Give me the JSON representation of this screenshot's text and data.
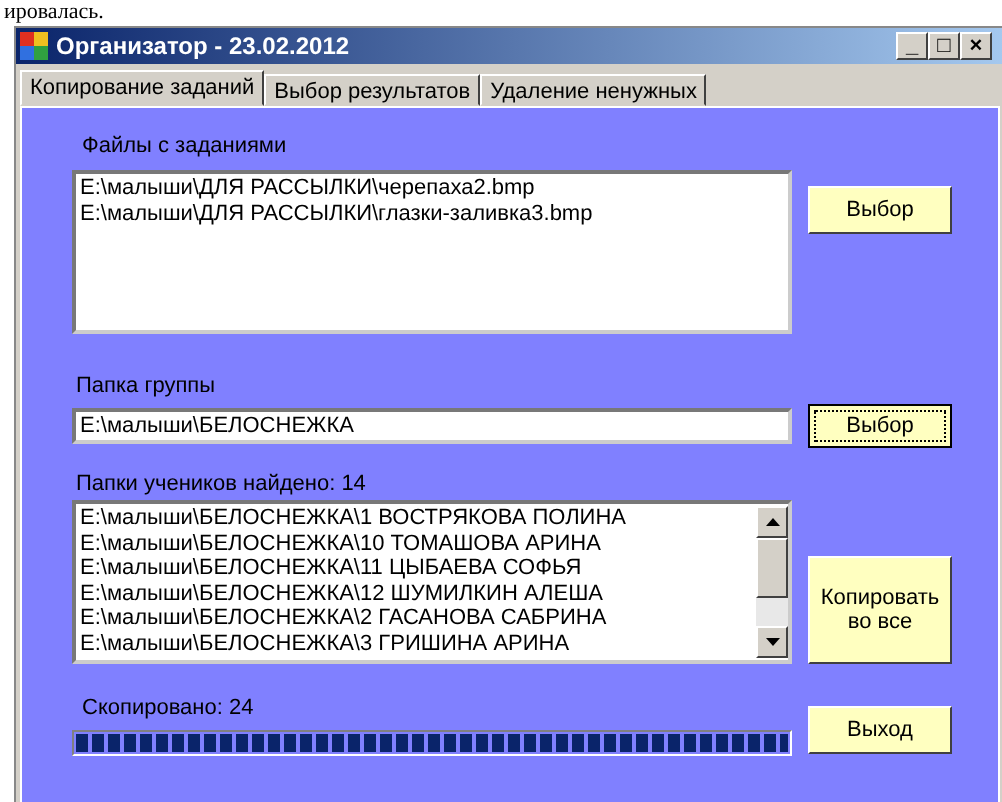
{
  "document_text": "ировалась.",
  "window": {
    "title": "Организатор - 23.02.2012"
  },
  "title_buttons": [
    "_",
    "□",
    "×"
  ],
  "tabs": [
    {
      "label": "Копирование заданий",
      "selected": true
    },
    {
      "label": "Выбор результатов",
      "selected": false
    },
    {
      "label": "Удаление ненужных",
      "selected": false
    }
  ],
  "task_files": {
    "label": "Файлы с заданиями",
    "items": [
      "E:\\малыши\\ДЛЯ РАССЫЛКИ\\черепаха2.bmp",
      "E:\\малыши\\ДЛЯ РАССЫЛКИ\\глазки-заливка3.bmp"
    ],
    "button": {
      "label": "Выбор",
      "focused": false
    }
  },
  "group_folder": {
    "label": "Папка группы",
    "value": "E:\\малыши\\БЕЛОСНЕЖКА",
    "button": {
      "label": "Выбор",
      "focused": true
    }
  },
  "student_folders": {
    "label": "Папки учеников найдено: 14",
    "items": [
      "E:\\малыши\\БЕЛОСНЕЖКА\\1 ВОСТРЯКОВА ПОЛИНА",
      "E:\\малыши\\БЕЛОСНЕЖКА\\10 ТОМАШОВА АРИНА",
      "E:\\малыши\\БЕЛОСНЕЖКА\\11 ЦЫБАЕВА СОФЬЯ",
      "E:\\малыши\\БЕЛОСНЕЖКА\\12 ШУМИЛКИН АЛЕША",
      "E:\\малыши\\БЕЛОСНЕЖКА\\2 ГАСАНОВА САБРИНА",
      "E:\\малыши\\БЕЛОСНЕЖКА\\3 ГРИШИНА АРИНА"
    ],
    "button": {
      "label": "Копировать во все",
      "focused": false
    }
  },
  "progress": {
    "label": "Скопировано: 24",
    "level": 1.0
  },
  "exit_button": {
    "label": "Выход",
    "focused": false
  }
}
